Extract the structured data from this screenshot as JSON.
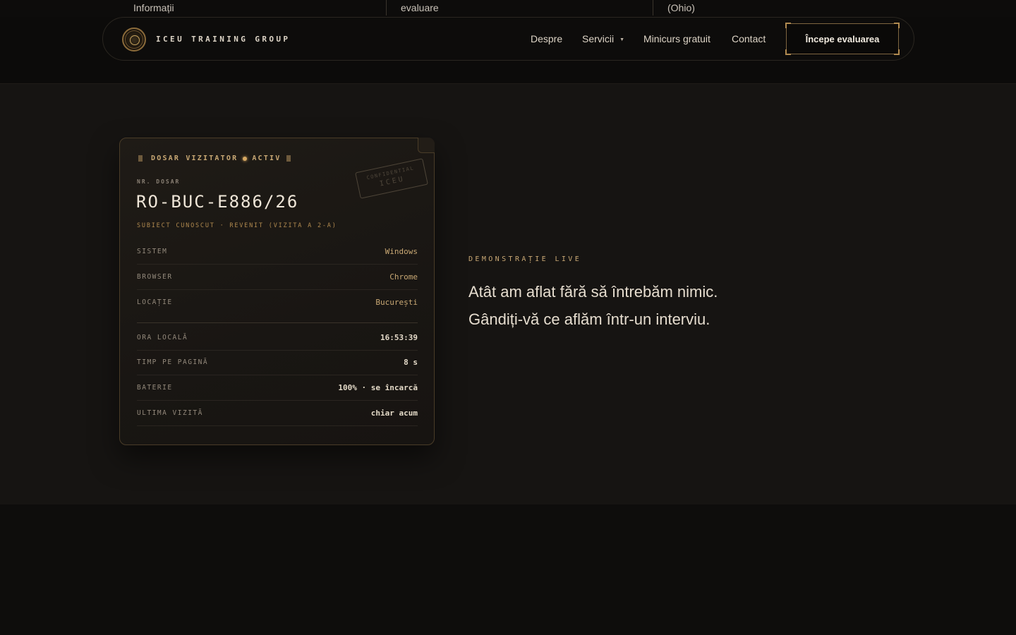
{
  "top_strip": {
    "cells": [
      "Informații",
      "evaluare",
      "(Ohio)"
    ]
  },
  "nav": {
    "brand": "ICEU TRAINING GROUP",
    "links": [
      "Despre",
      "Servicii",
      "Minicurs gratuit",
      "Contact"
    ],
    "cta": "Începe evaluarea"
  },
  "card": {
    "header_left": "DOSAR VIZITATOR",
    "header_right": "ACTIV",
    "file_label": "NR. DOSAR",
    "file_number": "RO-BUC-E886/26",
    "subject": "SUBIECT CUNOSCUT · REVENIT (VIZITA A 2-A)",
    "stamp_top": "CONFIDENTIAL",
    "stamp_bottom": "ICEU",
    "rows_top": [
      {
        "key": "SISTEM",
        "value": "Windows"
      },
      {
        "key": "BROWSER",
        "value": "Chrome"
      },
      {
        "key": "LOCAȚIE",
        "value": "București"
      }
    ],
    "rows_bottom": [
      {
        "key": "ORA LOCALĂ",
        "value": "16:53:39"
      },
      {
        "key": "TIMP PE PAGINĂ",
        "value": "8 s"
      },
      {
        "key": "BATERIE",
        "value": "100% · se încarcă"
      },
      {
        "key": "ULTIMA VIZITĂ",
        "value": "chiar acum"
      }
    ]
  },
  "demo": {
    "label": "DEMONSTRAȚIE LIVE",
    "line1": "Atât am aflat fără să întrebăm nimic.",
    "line2": "Gândiți-vă ce aflăm într-un interviu."
  },
  "colors": {
    "accent": "#c9a874",
    "background": "#161412",
    "header": "#0c0b0a"
  }
}
